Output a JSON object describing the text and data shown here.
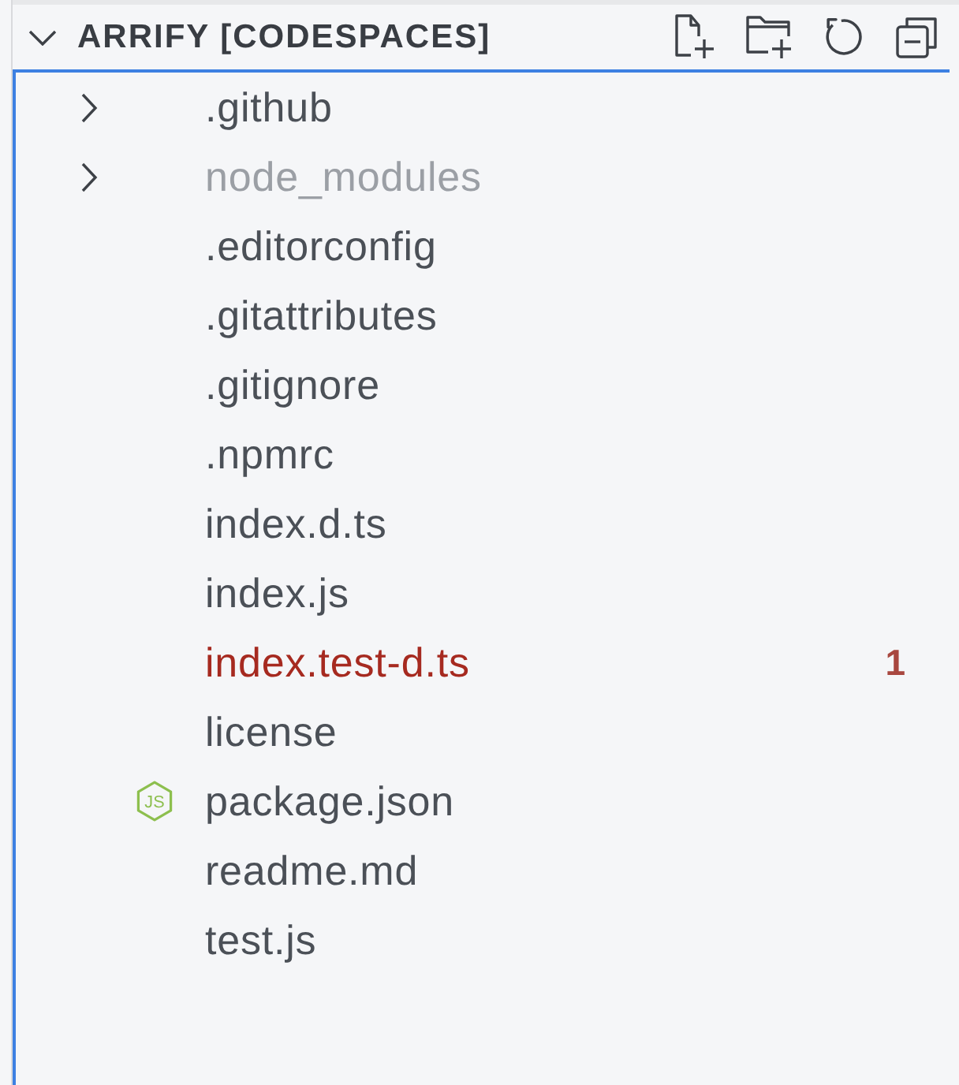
{
  "explorer": {
    "title": "ARRIFY [CODESPACES]",
    "expanded": true
  },
  "items": [
    {
      "name": ".github",
      "kind": "folder",
      "expanded": false,
      "dimmed": false,
      "error": false
    },
    {
      "name": "node_modules",
      "kind": "folder",
      "expanded": false,
      "dimmed": true,
      "error": false
    },
    {
      "name": ".editorconfig",
      "kind": "file",
      "dimmed": false,
      "error": false
    },
    {
      "name": ".gitattributes",
      "kind": "file",
      "dimmed": false,
      "error": false
    },
    {
      "name": ".gitignore",
      "kind": "file",
      "dimmed": false,
      "error": false
    },
    {
      "name": ".npmrc",
      "kind": "file",
      "dimmed": false,
      "error": false
    },
    {
      "name": "index.d.ts",
      "kind": "file",
      "dimmed": false,
      "error": false
    },
    {
      "name": "index.js",
      "kind": "file",
      "dimmed": false,
      "error": false
    },
    {
      "name": "index.test-d.ts",
      "kind": "file",
      "dimmed": false,
      "error": true,
      "badge": "1"
    },
    {
      "name": "license",
      "kind": "file",
      "dimmed": false,
      "error": false
    },
    {
      "name": "package.json",
      "kind": "package",
      "icon_text": "JS",
      "dimmed": false,
      "error": false
    },
    {
      "name": "readme.md",
      "kind": "file",
      "dimmed": false,
      "error": false
    },
    {
      "name": "test.js",
      "kind": "file",
      "dimmed": false,
      "error": false
    }
  ]
}
